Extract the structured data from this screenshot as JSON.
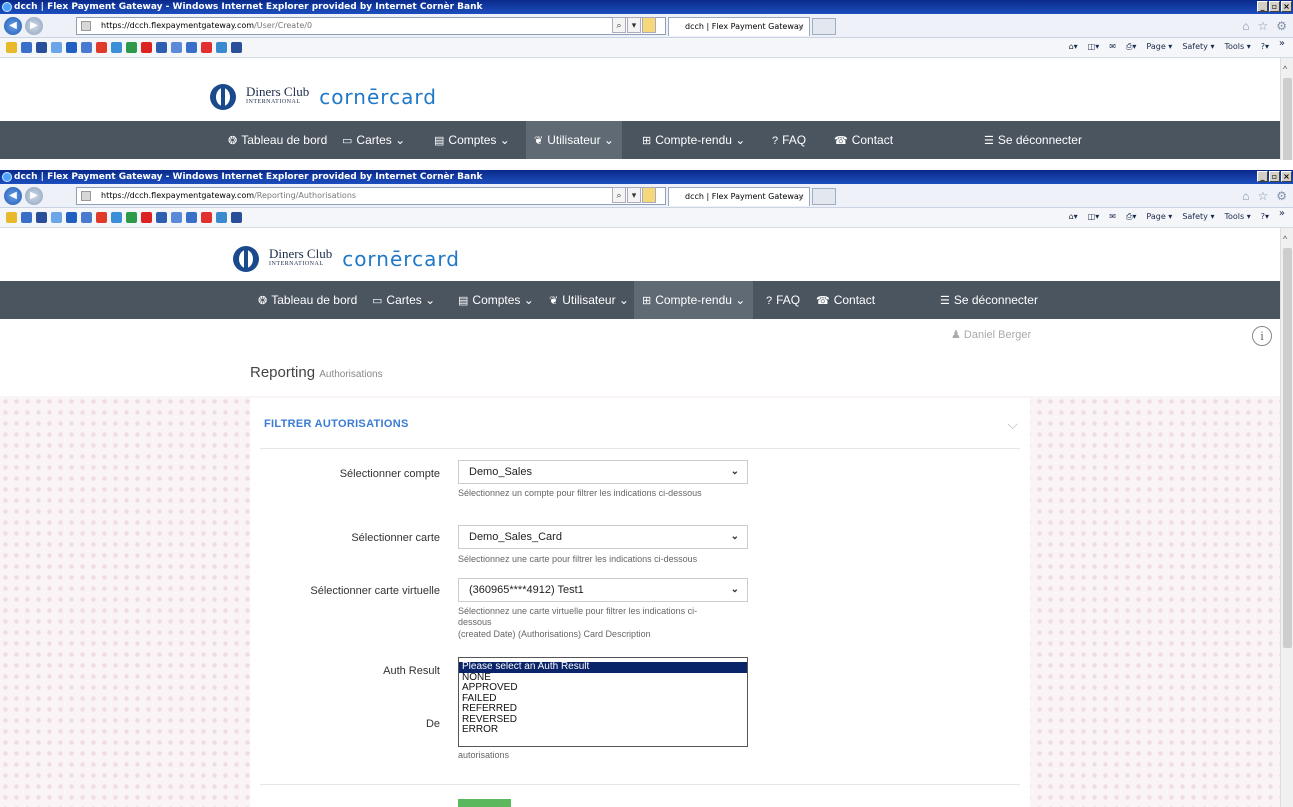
{
  "window1": {
    "title": "dcch | Flex Payment Gateway - Windows Internet Explorer provided by Internet Cornèr Bank",
    "url_host": "https://dcch.flexpaymentgateway.com",
    "url_path": "/User/Create/0",
    "tab_label": "dcch | Flex Payment Gateway",
    "nav": [
      {
        "icon": "tachometer-icon",
        "glyph": "❂",
        "label": "Tableau de bord"
      },
      {
        "icon": "card-icon",
        "glyph": "▭",
        "label": "Cartes ⌄"
      },
      {
        "icon": "book-icon",
        "glyph": "▤",
        "label": "Comptes ⌄"
      },
      {
        "icon": "users-icon",
        "glyph": "❦",
        "label": "Utilisateur ⌄"
      },
      {
        "icon": "grid-icon",
        "glyph": "⊞",
        "label": "Compte-rendu ⌄"
      },
      {
        "icon": "question-icon",
        "glyph": "?",
        "label": "FAQ"
      },
      {
        "icon": "phone-icon",
        "glyph": "☎",
        "label": "Contact"
      },
      {
        "icon": "unlock-icon",
        "glyph": "☰",
        "label": "Se déconnecter"
      }
    ]
  },
  "window2": {
    "title": "dcch | Flex Payment Gateway - Windows Internet Explorer provided by Internet Cornèr Bank",
    "url_host": "https://dcch.flexpaymentgateway.com",
    "url_path": "/Reporting/Authorisations",
    "tab_label": "dcch | Flex Payment Gateway",
    "nav": [
      {
        "icon": "tachometer-icon",
        "glyph": "❂",
        "label": "Tableau de bord"
      },
      {
        "icon": "card-icon",
        "glyph": "▭",
        "label": "Cartes ⌄"
      },
      {
        "icon": "book-icon",
        "glyph": "▤",
        "label": "Comptes ⌄"
      },
      {
        "icon": "users-icon",
        "glyph": "❦",
        "label": "Utilisateur ⌄"
      },
      {
        "icon": "grid-icon",
        "glyph": "⊞",
        "label": "Compte-rendu ⌄"
      },
      {
        "icon": "question-icon",
        "glyph": "?",
        "label": "FAQ"
      },
      {
        "icon": "phone-icon",
        "glyph": "☎",
        "label": "Contact"
      },
      {
        "icon": "unlock-icon",
        "glyph": "☰",
        "label": "Se déconnecter"
      }
    ],
    "user_name": "Daniel Berger",
    "page_title": "Reporting",
    "page_subtitle": "Authorisations",
    "filter": {
      "title": "FILTRER AUTORISATIONS",
      "account_label": "Sélectionner compte",
      "account_value": "Demo_Sales",
      "account_help": "Sélectionnez un compte pour filtrer les indications ci-dessous",
      "card_label": "Sélectionner carte",
      "card_value": "Demo_Sales_Card",
      "card_help": "Sélectionnez une carte pour filtrer les indications ci-dessous",
      "vcard_label": "Sélectionner carte virtuelle",
      "vcard_value": "(360965****4912) Test1",
      "vcard_help": "Sélectionnez une carte virtuelle pour filtrer les indications ci-dessous",
      "vcard_help2": "(created Date) (Authorisations) Card Description",
      "auth_label": "Auth Result",
      "auth_options": [
        "Please select an Auth Result",
        "NONE",
        "APPROVED",
        "FAILED",
        "REFERRED",
        "REVERSED",
        "ERROR"
      ],
      "auth_selected_index": 0,
      "from_label": "De",
      "from_help": "autorisations"
    }
  },
  "logo": {
    "diners_line1": "Diners Club",
    "diners_line2": "INTERNATIONAL",
    "cornercard": "cornērcard"
  },
  "ie_cmd": [
    "Page ▾",
    "Safety ▾",
    "Tools ▾"
  ],
  "colors": {
    "navbar": "#4b5560",
    "accent": "#3a7bd5",
    "submit": "#5cb85c"
  }
}
